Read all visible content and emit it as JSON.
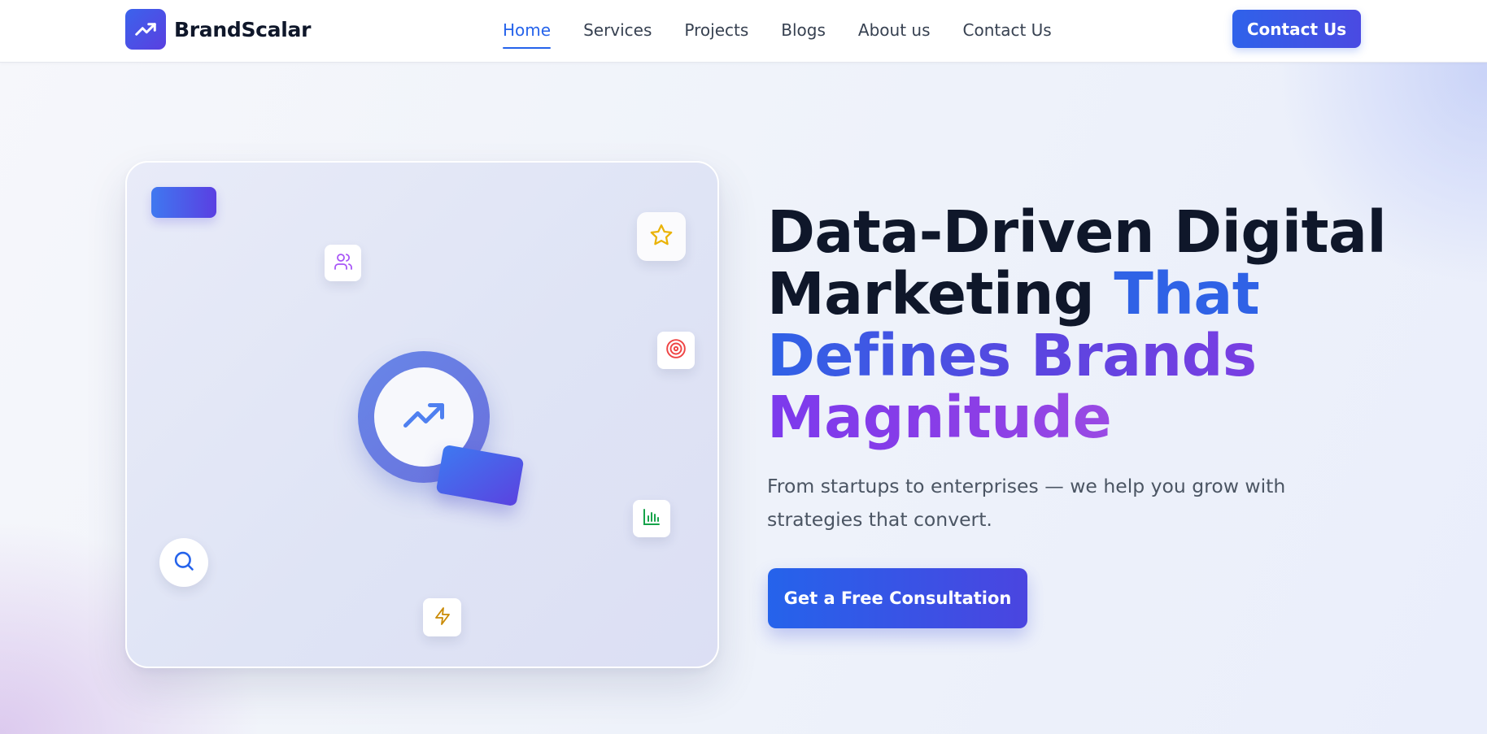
{
  "brand": {
    "name": "BrandScalar",
    "logo_icon": "trending-up-icon"
  },
  "nav": {
    "items": [
      {
        "label": "Home",
        "active": true
      },
      {
        "label": "Services",
        "active": false
      },
      {
        "label": "Projects",
        "active": false
      },
      {
        "label": "Blogs",
        "active": false
      },
      {
        "label": "About us",
        "active": false
      },
      {
        "label": "Contact Us",
        "active": false
      }
    ],
    "cta_label": "Contact Us"
  },
  "hero": {
    "headline": {
      "line1": "Data-Driven Digital",
      "line2_dark": "Marketing ",
      "line2_accent": "That",
      "line3": "Defines Brands",
      "line4": "Magnitude"
    },
    "subtitle": "From startups to enterprises — we help you grow with strategies that convert.",
    "cta_label": "Get a Free Consultation"
  },
  "illustration": {
    "icons": [
      "users-icon",
      "star-icon",
      "target-icon",
      "bar-chart-icon",
      "search-icon",
      "lightning-icon",
      "trending-up-icon"
    ]
  },
  "colors": {
    "primary": "#2563eb",
    "accent_purple": "#7c3aed",
    "text_dark": "#0f172a",
    "text_muted": "#4b5563",
    "star": "#eab308",
    "target": "#ef4444",
    "chart": "#16a34a",
    "users": "#a855f7",
    "bolt": "#ca8a04"
  }
}
